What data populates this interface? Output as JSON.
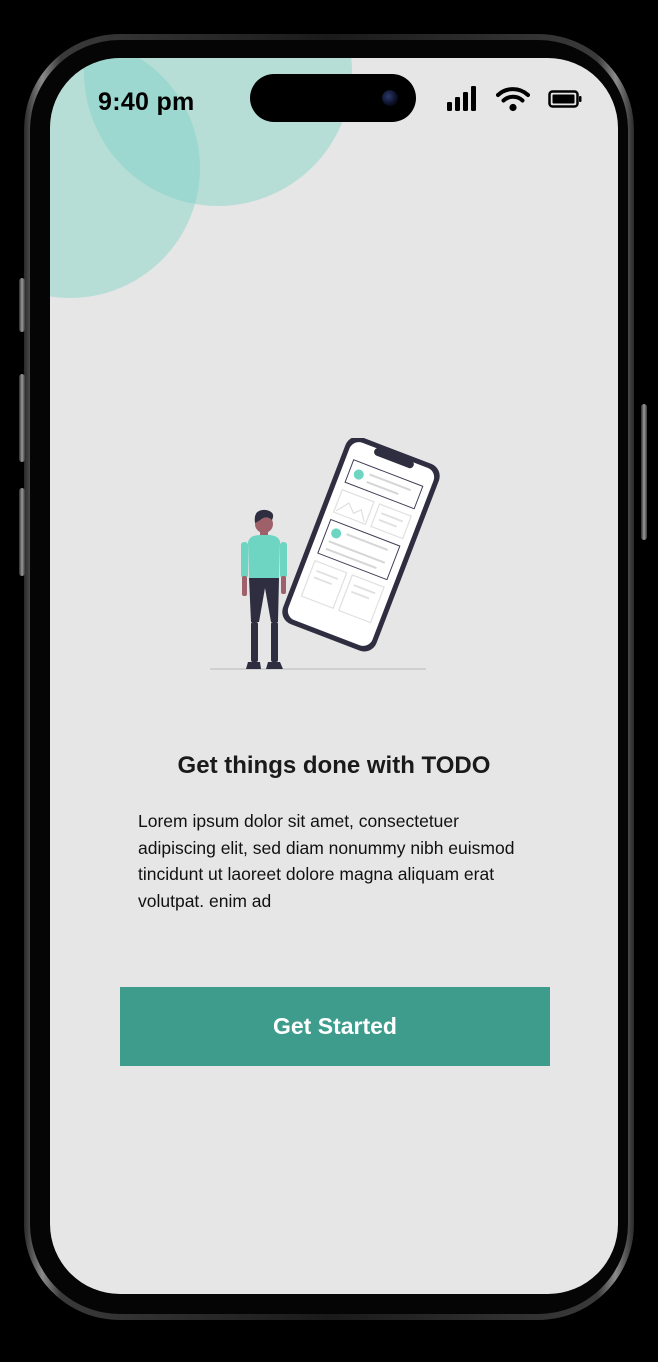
{
  "status_bar": {
    "time": "9:40 pm",
    "icons": [
      "cellular-signal-icon",
      "wifi-icon",
      "battery-icon"
    ]
  },
  "onboarding": {
    "illustration": "person-with-phone-illustration",
    "title": "Get things done with TODO",
    "description": "Lorem ipsum dolor sit amet, consectetuer adipiscing elit, sed diam nonummy nibh euismod tincidunt ut laoreet dolore magna aliquam erat volutpat.  enim ad",
    "cta_label": "Get Started"
  },
  "colors": {
    "accent": "#3d9c8c",
    "accent_light": "#78d2c3",
    "screen_background": "#e6e6e6",
    "text_primary": "#1a1a1a"
  }
}
